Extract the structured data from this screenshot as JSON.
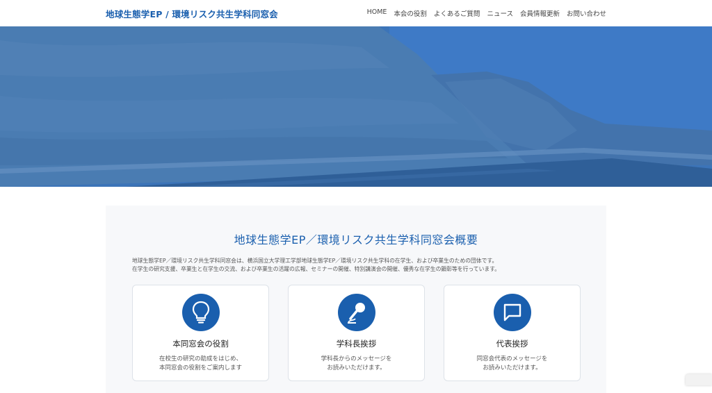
{
  "site": {
    "title": "地球生態学EP / 環境リスク共生学科同窓会"
  },
  "nav": [
    {
      "label": "HOME"
    },
    {
      "label": "本会の役割"
    },
    {
      "label": "よくあるご質問"
    },
    {
      "label": "ニュース"
    },
    {
      "label": "会員情報更新"
    },
    {
      "label": "お問い合わせ"
    }
  ],
  "overview": {
    "title": "地球生態学EP／環境リスク共生学科同窓会概要",
    "desc_line1": "地球生態学EP／環境リスク共生学科同窓会は、横浜国立大学理工学部地球生態学EP／環境リスク共生学科の在学生、および卒業生のための団体です。",
    "desc_line2": "在学生の研究支援、卒業生と在学生の交流、および卒業生の活躍の広報、セミナーの開催、特別講演会の開催、優秀な在学生の顕彰等を行っています。"
  },
  "cards": [
    {
      "icon": "lightbulb-icon",
      "title": "本同窓会の役割",
      "line1": "在校生の研究の助成をはじめ、",
      "line2": "本同窓会の役割をご案内します"
    },
    {
      "icon": "microphone-icon",
      "title": "学科長挨拶",
      "line1": "学科長からのメッセージを",
      "line2": "お読みいただけます。"
    },
    {
      "icon": "chat-icon",
      "title": "代表挨拶",
      "line1": "同窓会代表のメッセージを",
      "line2": "お読みいただけます。"
    }
  ],
  "colors": {
    "brand": "#1a5fae",
    "hero_tint": "#3d73b4"
  }
}
